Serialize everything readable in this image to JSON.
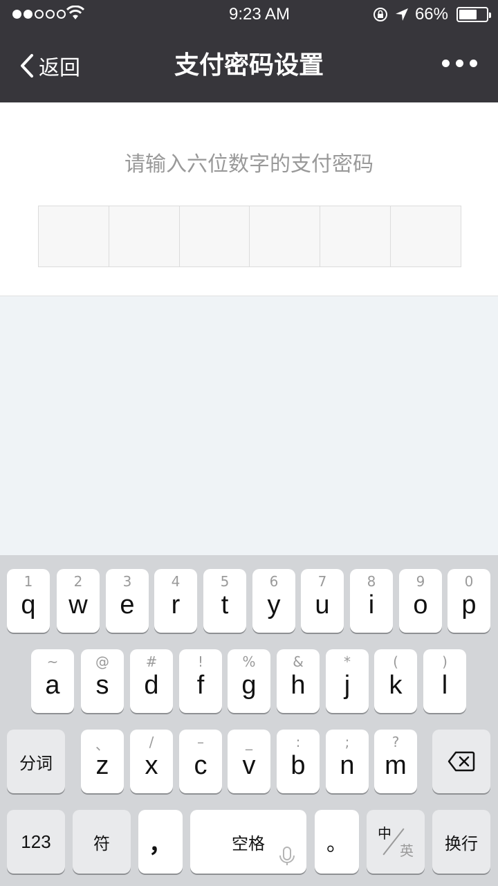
{
  "status": {
    "time": "9:23 AM",
    "battery": "66%",
    "battery_fill": 0.66
  },
  "nav": {
    "back_label": "返回",
    "title": "支付密码设置"
  },
  "content": {
    "prompt": "请输入六位数字的支付密码"
  },
  "keyboard": {
    "row1": [
      {
        "hint": "1",
        "letter": "q"
      },
      {
        "hint": "2",
        "letter": "w"
      },
      {
        "hint": "3",
        "letter": "e"
      },
      {
        "hint": "4",
        "letter": "r"
      },
      {
        "hint": "5",
        "letter": "t"
      },
      {
        "hint": "6",
        "letter": "y"
      },
      {
        "hint": "7",
        "letter": "u"
      },
      {
        "hint": "8",
        "letter": "i"
      },
      {
        "hint": "9",
        "letter": "o"
      },
      {
        "hint": "0",
        "letter": "p"
      }
    ],
    "row2": [
      {
        "hint": "~",
        "letter": "a"
      },
      {
        "hint": "@",
        "letter": "s"
      },
      {
        "hint": "#",
        "letter": "d"
      },
      {
        "hint": "!",
        "letter": "f"
      },
      {
        "hint": "%",
        "letter": "g"
      },
      {
        "hint": "&",
        "letter": "h"
      },
      {
        "hint": "*",
        "letter": "j"
      },
      {
        "hint": "(",
        "letter": "k"
      },
      {
        "hint": ")",
        "letter": "l"
      }
    ],
    "row3": [
      {
        "hint": "、",
        "letter": "z"
      },
      {
        "hint": "/",
        "letter": "x"
      },
      {
        "hint": "–",
        "letter": "c"
      },
      {
        "hint": "_",
        "letter": "v"
      },
      {
        "hint": ":",
        "letter": "b"
      },
      {
        "hint": ";",
        "letter": "n"
      },
      {
        "hint": "?",
        "letter": "m"
      }
    ],
    "segment_label": "分词",
    "numbers_label": "123",
    "symbols_label": "符",
    "comma_label": "，",
    "space_label": "空格",
    "period_label": "。",
    "lang_zh": "中",
    "lang_en": "英",
    "return_label": "换行"
  }
}
